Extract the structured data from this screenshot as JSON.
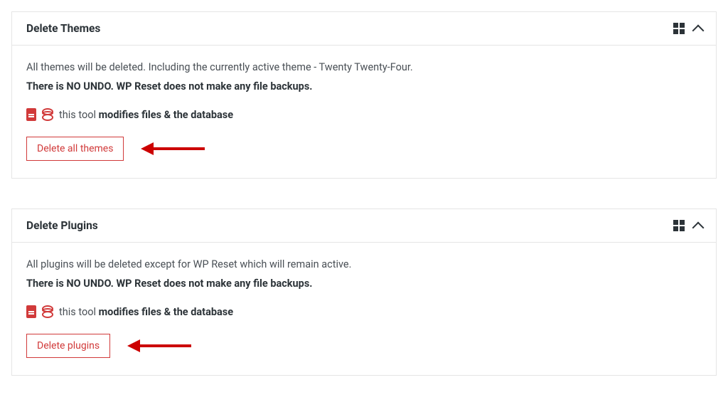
{
  "cards": [
    {
      "title": "Delete Themes",
      "desc": "All themes will be deleted. Including the currently active theme - Twenty Twenty-Four.",
      "warn": "There is NO UNDO. WP Reset does not make any file backups.",
      "tool_prefix": "this tool ",
      "tool_bold": "modifies files & the database",
      "button": "Delete all themes"
    },
    {
      "title": "Delete Plugins",
      "desc": "All plugins will be deleted except for WP Reset which will remain active.",
      "warn": "There is NO UNDO. WP Reset does not make any file backups.",
      "tool_prefix": "this tool ",
      "tool_bold": "modifies files & the database",
      "button": "Delete plugins"
    }
  ]
}
